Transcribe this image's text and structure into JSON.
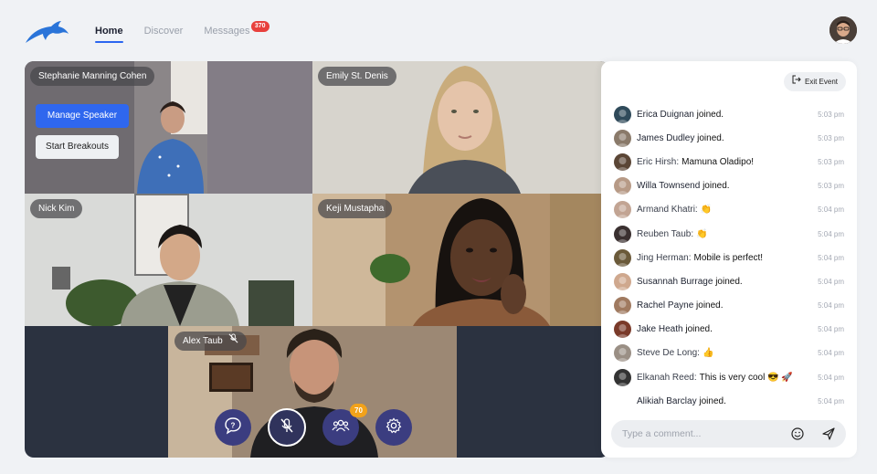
{
  "nav": {
    "home": "Home",
    "discover": "Discover",
    "messages": "Messages",
    "messages_badge": "370"
  },
  "stage": {
    "tiles": [
      {
        "name": "Stephanie Manning Cohen"
      },
      {
        "name": "Emily St. Denis"
      },
      {
        "name": "Nick Kim"
      },
      {
        "name": "Keji Mustapha"
      },
      {
        "name": "Alex Taub"
      }
    ],
    "manage_speaker": "Manage Speaker",
    "start_breakouts": "Start Breakouts",
    "attendee_count": "70"
  },
  "chat": {
    "exit_label": "Exit Event",
    "messages": [
      {
        "name": "Erica Duignan",
        "text": "joined.",
        "time": "5:03 pm",
        "joined": true
      },
      {
        "name": "James Dudley",
        "text": "joined.",
        "time": "5:03 pm",
        "joined": true
      },
      {
        "name": "Eric Hirsh",
        "text": "Mamuna Oladipo!",
        "time": "5:03 pm",
        "joined": false
      },
      {
        "name": "Willa Townsend",
        "text": "joined.",
        "time": "5:03 pm",
        "joined": true
      },
      {
        "name": "Armand Khatri",
        "text": "👏",
        "time": "5:04 pm",
        "joined": false
      },
      {
        "name": "Reuben Taub",
        "text": "👏",
        "time": "5:04 pm",
        "joined": false
      },
      {
        "name": "Jing Herman",
        "text": "Mobile is perfect!",
        "time": "5:04 pm",
        "joined": false
      },
      {
        "name": "Susannah Burrage",
        "text": "joined.",
        "time": "5:04 pm",
        "joined": true
      },
      {
        "name": "Rachel Payne",
        "text": "joined.",
        "time": "5:04 pm",
        "joined": true
      },
      {
        "name": "Jake Heath",
        "text": "joined.",
        "time": "5:04 pm",
        "joined": true
      },
      {
        "name": "Steve De Long",
        "text": "👍",
        "time": "5:04 pm",
        "joined": false
      },
      {
        "name": "Elkanah Reed",
        "text": "This is very cool 😎 🚀",
        "time": "5:04 pm",
        "joined": false
      },
      {
        "name": "Alikiah Barclay",
        "text": "joined.",
        "time": "5:04 pm",
        "joined": true
      }
    ],
    "comment_placeholder": "Type a comment..."
  },
  "colors": {
    "accent": "#2f67ee",
    "badge": "#e8403c",
    "control": "#3b3d80",
    "attendee_badge": "#f2a21a"
  }
}
